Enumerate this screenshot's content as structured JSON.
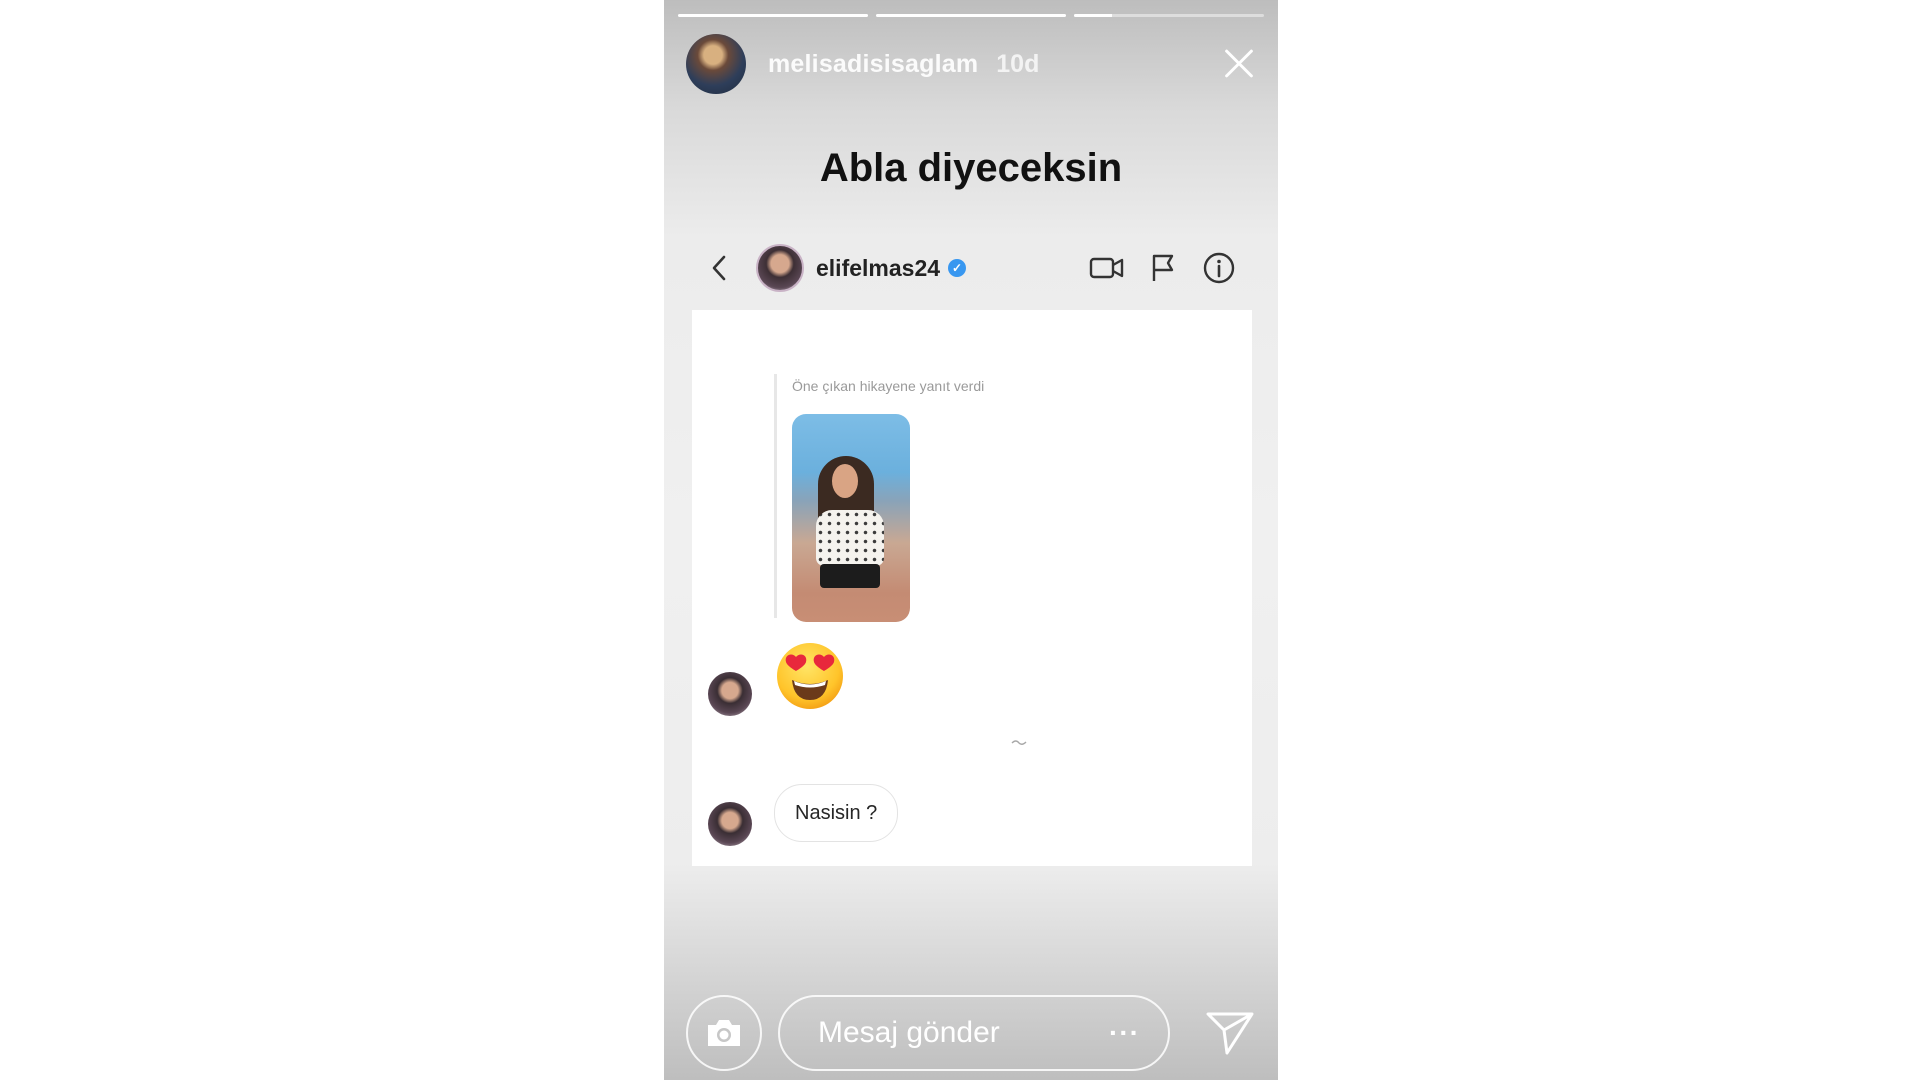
{
  "story": {
    "username": "melisadisisaglam",
    "time": "10d",
    "progress": [
      1,
      1,
      0.2
    ],
    "caption": "Abla diyeceksin"
  },
  "dm": {
    "username": "elifelmas24",
    "verified": true,
    "icons": [
      "back-icon",
      "video-call-icon",
      "flag-icon",
      "info-icon"
    ],
    "reply_label": "Öne çıkan hikayene yanıt verdi",
    "messages": [
      {
        "type": "emoji",
        "emoji": "heart-eyes"
      },
      {
        "type": "text",
        "text": "Nasisin ?"
      }
    ]
  },
  "footer": {
    "placeholder": "Mesaj gönder",
    "more": "···",
    "icons": [
      "camera-icon",
      "send-icon"
    ]
  },
  "colors": {
    "verified": "#3897f0",
    "caption": "#111111"
  }
}
